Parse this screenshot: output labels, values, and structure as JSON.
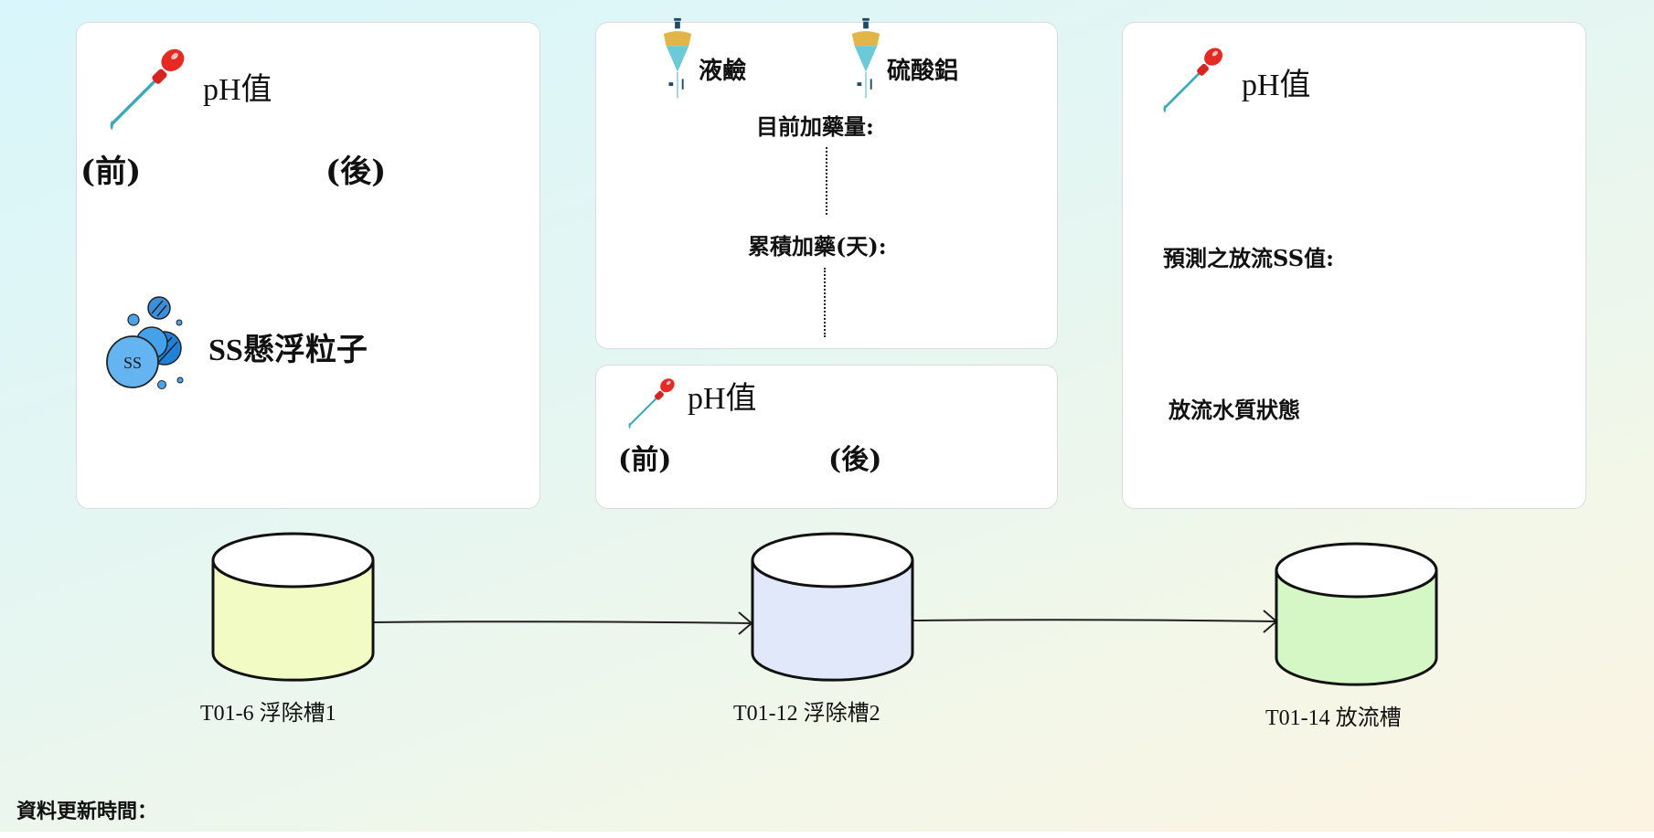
{
  "card_left": {
    "ph_title": "pH值",
    "before": "(前)",
    "after": "(後)",
    "ss_title": "SS懸浮粒子",
    "ss_icon_text": "SS"
  },
  "card_dosing": {
    "chem1": "液鹼",
    "chem2": "硫酸鋁",
    "current_dose_label": "目前加藥量:",
    "cumulative_label": "累積加藥(天):"
  },
  "card_ph_mid": {
    "ph_title": "pH值",
    "before": "(前)",
    "after": "(後)"
  },
  "card_right": {
    "ph_title": "pH值",
    "predicted_ss_label": "預測之放流SS值:",
    "quality_label": "放流水質狀態"
  },
  "tanks": [
    {
      "label": "T01-6 浮除槽1",
      "color": "#f3fbc4"
    },
    {
      "label": "T01-12 浮除槽2",
      "color": "#e1e8fa"
    },
    {
      "label": "T01-14 放流槽",
      "color": "#d5f6c5"
    }
  ],
  "footer": {
    "update_time_label": "資料更新時間："
  }
}
